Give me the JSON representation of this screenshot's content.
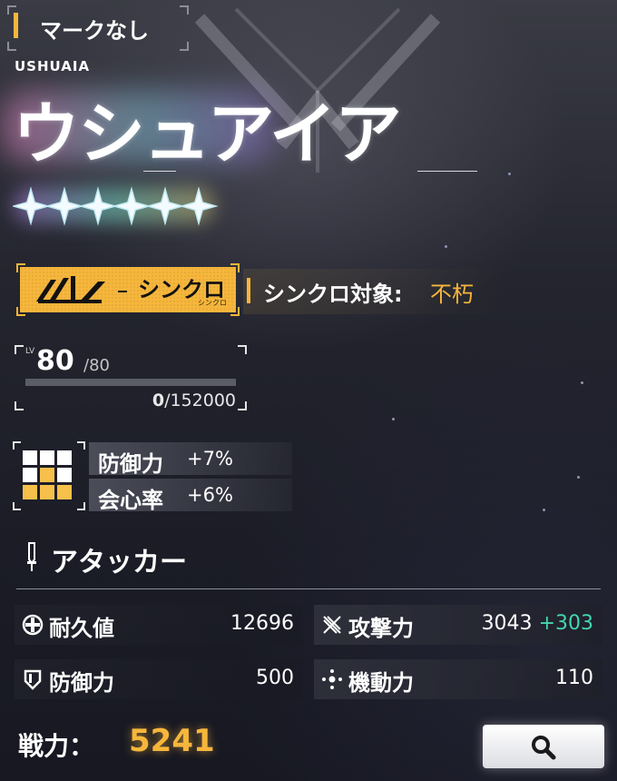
{
  "header": {
    "mark_label": "マークなし"
  },
  "character": {
    "name_en": "USHUAIA",
    "name_jp": "ウシュアイア",
    "rarity_stars": 6
  },
  "sync": {
    "badge_label": "シンクロ",
    "badge_sub": "シンクロ",
    "target_label": "シンクロ対象:",
    "target_value": "不朽"
  },
  "level": {
    "lv_tag": "LV",
    "current": "80",
    "max": "/80",
    "exp_fraction": 0,
    "exp": "0",
    "exp_total": "/152000"
  },
  "bonuses": [
    {
      "label": "防御力",
      "value": "+7%"
    },
    {
      "label": "会心率",
      "value": "+6%"
    }
  ],
  "grid": {
    "filled_color": "#f6c04a",
    "empty_color": "#ffffff",
    "cells": [
      false,
      false,
      false,
      false,
      true,
      false,
      true,
      true,
      true
    ]
  },
  "role": {
    "icon": "sword-icon",
    "label": "アタッカー"
  },
  "stats": {
    "durability": {
      "icon": "cross-icon",
      "label": "耐久値",
      "value": "12696"
    },
    "attack": {
      "icon": "crossed-blades-icon",
      "label": "攻撃力",
      "value": "3043",
      "bonus": "+303"
    },
    "defense": {
      "icon": "shield-icon",
      "label": "防御力",
      "value": "500"
    },
    "mobility": {
      "icon": "move-icon",
      "label": "機動力",
      "value": "110"
    }
  },
  "power": {
    "label": "戦力：",
    "value": "5241"
  },
  "colors": {
    "accent": "#f6b63c",
    "bonus_green": "#43d6b0"
  }
}
